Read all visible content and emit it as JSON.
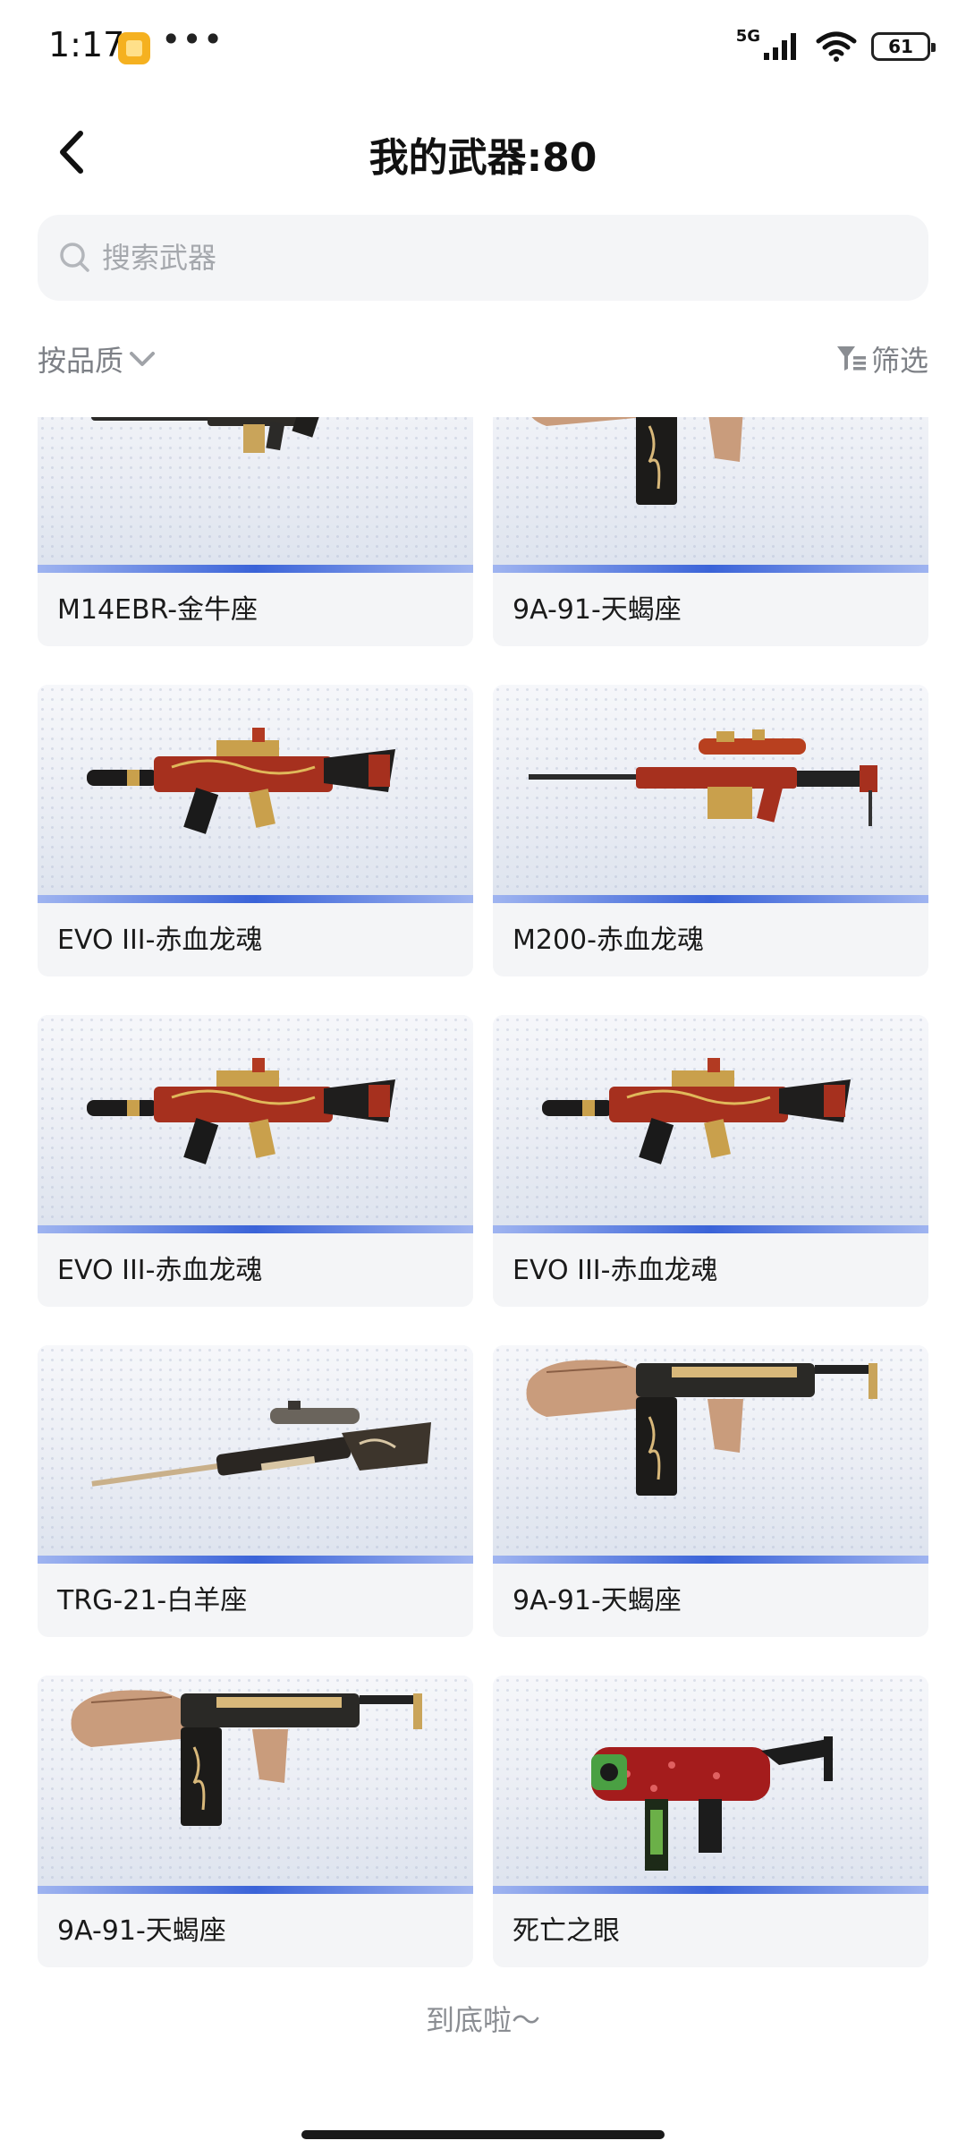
{
  "status_bar": {
    "time": "1:17",
    "dots": "•••",
    "network": "5G",
    "battery": "61"
  },
  "header": {
    "title": "我的武器:80"
  },
  "search": {
    "placeholder": "搜索武器"
  },
  "filters": {
    "sort_label": "按品质",
    "filter_label": "筛选"
  },
  "weapons": [
    {
      "name": "M14EBR-金牛座",
      "icon": "rifle-gold-black"
    },
    {
      "name": "9A-91-天蝎座",
      "icon": "carbine-copper-scorpion"
    },
    {
      "name": "EVO III-赤血龙魂",
      "icon": "smg-red-gold-dragon"
    },
    {
      "name": "M200-赤血龙魂",
      "icon": "sniper-red-gold-dragon"
    },
    {
      "name": "EVO III-赤血龙魂",
      "icon": "smg-red-gold-dragon"
    },
    {
      "name": "EVO III-赤血龙魂",
      "icon": "smg-red-gold-dragon"
    },
    {
      "name": "TRG-21-白羊座",
      "icon": "sniper-bronze-ram"
    },
    {
      "name": "9A-91-天蝎座",
      "icon": "carbine-copper-scorpion"
    },
    {
      "name": "9A-91-天蝎座",
      "icon": "carbine-copper-scorpion"
    },
    {
      "name": "死亡之眼",
      "icon": "machine-pistol-red-green"
    }
  ],
  "footer": {
    "end_text": "到底啦～"
  },
  "colors": {
    "accent_stripe": "#3a63d8",
    "card_bg": "#f4f5f7",
    "muted_text": "#7d8086"
  }
}
